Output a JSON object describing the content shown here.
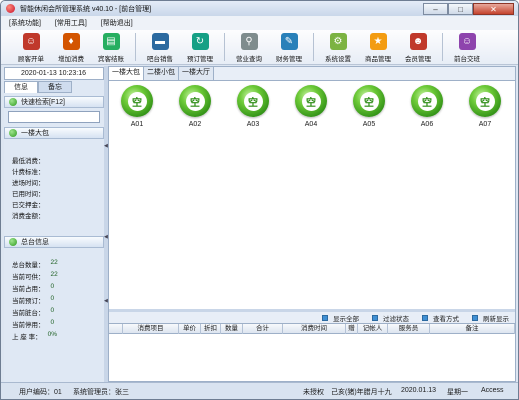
{
  "window": {
    "title": "智能休闲会所管理系统 v40.10 - [前台管理]",
    "controls": {
      "minimize": "–",
      "maximize": "□",
      "close": "✕"
    }
  },
  "menu": [
    "[系统功能]",
    "[常用工具]",
    "[帮助退出]"
  ],
  "toolbar": [
    {
      "label": "顾客开单",
      "icon": "customer-icon",
      "color": "#c0392b",
      "glyph": "☺"
    },
    {
      "label": "增加消费",
      "icon": "add-consume-icon",
      "color": "#d35400",
      "glyph": "♦"
    },
    {
      "label": "宾客结账",
      "icon": "checkout-icon",
      "color": "#27ae60",
      "glyph": "▤"
    },
    {
      "label": "吧台销售",
      "icon": "bar-sale-icon",
      "color": "#2c6aa0",
      "glyph": "▬"
    },
    {
      "label": "预订管理",
      "icon": "booking-icon",
      "color": "#16a085",
      "glyph": "↻"
    },
    {
      "label": "营业查询",
      "icon": "query-icon",
      "color": "#7f8c8d",
      "glyph": "⚲"
    },
    {
      "label": "财务管理",
      "icon": "finance-icon",
      "color": "#2980b9",
      "glyph": "✎"
    },
    {
      "label": "系统设置",
      "icon": "settings-icon",
      "color": "#7cb342",
      "glyph": "⚙"
    },
    {
      "label": "商品管理",
      "icon": "goods-icon",
      "color": "#f39c12",
      "glyph": "★"
    },
    {
      "label": "会员管理",
      "icon": "member-icon",
      "color": "#c0392b",
      "glyph": "☻"
    },
    {
      "label": "前台交班",
      "icon": "shift-icon",
      "color": "#8e44ad",
      "glyph": "☺"
    }
  ],
  "left": {
    "datetime": "2020-01-13 10:23:16",
    "tabs": [
      "信息",
      "备忘"
    ],
    "quick_search": "快速检索[F12]",
    "hall_panel": "一楼大包",
    "room_fields": [
      "最低消费：",
      "计费标准：",
      "进场时间：",
      "已用时间：",
      "已交押金：",
      "消费金额："
    ],
    "stats_panel": "总台信息",
    "stats": [
      {
        "label": "总台数量：",
        "value": "22"
      },
      {
        "label": "当前可供：",
        "value": "22"
      },
      {
        "label": "当前占用：",
        "value": "0"
      },
      {
        "label": "当前预订：",
        "value": "0"
      },
      {
        "label": "当前脏台：",
        "value": "0"
      },
      {
        "label": "当前停用：",
        "value": "0"
      },
      {
        "label": "上 座 率：",
        "value": "0%"
      }
    ]
  },
  "area_tabs": [
    "一楼大包",
    "二楼小包",
    "一楼大厅"
  ],
  "rooms": [
    {
      "code": "A01",
      "status": "空"
    },
    {
      "code": "A02",
      "status": "空"
    },
    {
      "code": "A03",
      "status": "空"
    },
    {
      "code": "A04",
      "status": "空"
    },
    {
      "code": "A05",
      "status": "空"
    },
    {
      "code": "A06",
      "status": "空"
    },
    {
      "code": "A07",
      "status": "空"
    }
  ],
  "actions": [
    "显示全部",
    "过滤状态",
    "查看方式",
    "刷新显示"
  ],
  "grid_columns": [
    "",
    "消费项目",
    "单价",
    "折扣",
    "数量",
    "合计",
    "消费时间",
    "赠",
    "记帐人",
    "服务员",
    "备注"
  ],
  "status": {
    "user": "用户编码：01",
    "admin": "系统管理员：张三",
    "auth": "未授权",
    "lunar": "己亥(猪)年腊月十九",
    "date": "2020.01.13",
    "weekday": "星期一",
    "db": "Access"
  }
}
